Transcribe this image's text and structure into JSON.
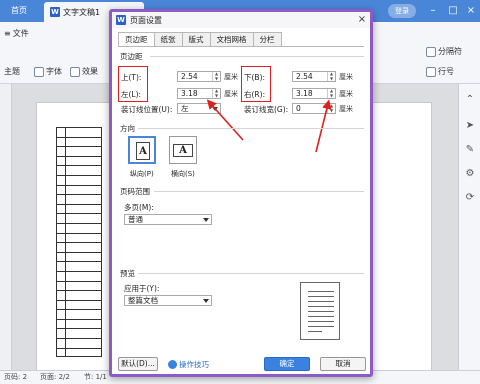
{
  "app": {
    "home_tab": "首页",
    "doc_tab": "文字文稿1",
    "login": "登录",
    "ribbon": {
      "file": "文件",
      "theme": "主题",
      "font": "字体",
      "effects": "效果",
      "delimiter": "分隔符",
      "line_no": "行号"
    },
    "status": {
      "page": "页码: 2",
      "pages": "页面: 2/2",
      "section": "节: 1/1"
    }
  },
  "dialog": {
    "title": "页面设置",
    "tabs": [
      "页边距",
      "纸张",
      "版式",
      "文档网格",
      "分栏"
    ],
    "margins": {
      "group": "页边距",
      "top_label": "上(T):",
      "top_value": "2.54",
      "bottom_label": "下(B):",
      "bottom_value": "2.54",
      "left_label": "左(L):",
      "left_value": "3.18",
      "right_label": "右(R):",
      "right_value": "3.18",
      "unit": "厘米",
      "gutter_pos_label": "装订线位置(U):",
      "gutter_pos_value": "左",
      "gutter_width_label": "装订线宽(G):",
      "gutter_width_value": "0"
    },
    "orientation": {
      "group": "方向",
      "portrait": "纵向(P)",
      "landscape": "横向(S)",
      "glyph": "A"
    },
    "page_range": {
      "group": "页码范围",
      "multi_label": "多页(M):",
      "multi_value": "普通"
    },
    "preview": {
      "group": "预览",
      "apply_label": "应用于(Y):",
      "apply_value": "整篇文档"
    },
    "buttons": {
      "default": "默认(D)...",
      "tips": "操作技巧",
      "ok": "确定",
      "cancel": "取消"
    }
  },
  "colors": {
    "accent": "#4a86d8",
    "dialog_border": "#8c5cc6",
    "annotation": "#e02020"
  }
}
